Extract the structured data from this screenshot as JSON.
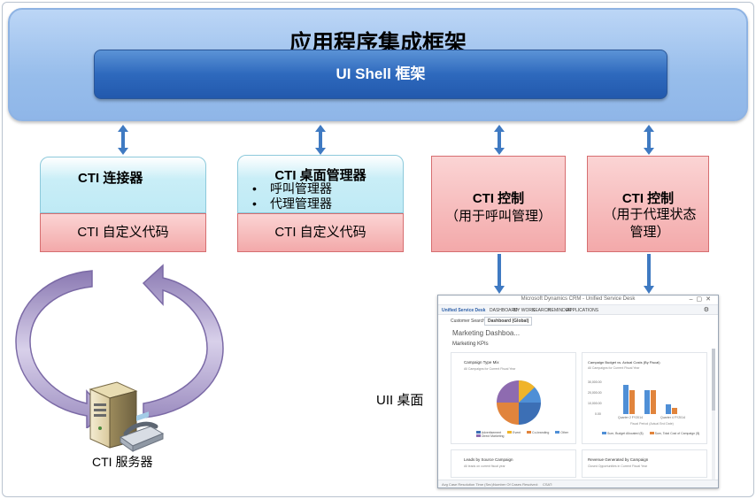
{
  "framework": {
    "title": "应用程序集成框架",
    "shell_label": "UI Shell 框架"
  },
  "boxes": {
    "connector": {
      "title": "CTI 连接器",
      "custom_code": "CTI 自定义代码"
    },
    "desktop_manager": {
      "title": "CTI 桌面管理器",
      "items": [
        "呼叫管理器",
        "代理管理器"
      ],
      "custom_code": "CTI 自定义代码"
    },
    "control_call": {
      "title": "CTI 控制",
      "subtitle": "（用于呼叫管理）"
    },
    "control_agent": {
      "title": "CTI 控制",
      "subtitle": "（用于代理状态管理）"
    }
  },
  "server_label": "CTI 服务器",
  "desktop_label": "UII 桌面",
  "uii_window": {
    "window_title": "Microsoft Dynamics CRM - Unified Service Desk",
    "app_name": "Unified Service Desk",
    "nav": [
      "DASHBOARD",
      "MY WORK",
      "SEARCH",
      "REMINDER",
      "APPLICATIONS"
    ],
    "tabs": [
      "Customer Search",
      "Dashboard (Global)"
    ],
    "dashboard_title": "Marketing Dashboa...",
    "section": "Marketing KPIs",
    "panels": [
      {
        "title": "Campaign Type Mix",
        "subtitle": "All Campaigns for Current Fiscal Year"
      },
      {
        "title": "Campaign Budget vs. Actual Costs (By Fiscal)",
        "subtitle": "All Campaigns for Current Fiscal Year"
      },
      {
        "title": "Leads by Source Campaign",
        "subtitle": "All leads on current fiscal year"
      },
      {
        "title": "Revenue Generated by Campaign",
        "subtitle": "Closed Opportunities in Current Fiscal Year"
      }
    ],
    "pie_legend": [
      "Advertisement",
      "Event",
      "Co-branding",
      "Other",
      "Direct Marketing"
    ],
    "bar_legend": [
      "Sum, Budget Allocated ($)",
      "Sum, Total Cost of Campaign ($)"
    ],
    "bar_yticks": [
      "30,000.00",
      "20,000.00",
      "10,000.00",
      "0.00"
    ],
    "bar_xticks": [
      "Quarter 2 FY2014",
      "Quarter 4 FY2014"
    ],
    "bar_xlabel": "Fiscal Period (Actual End Date)",
    "status_items": [
      "Avg Case Resolution Time (Sec):",
      "Number Of Cases Resolved:",
      "CSAT:"
    ],
    "colors": {
      "pie": [
        "#3c6fb5",
        "#f0b429",
        "#e1843c",
        "#8e6bb0",
        "#4f8fd6"
      ],
      "bars": [
        "#4f8fd6",
        "#e1843c"
      ]
    }
  }
}
